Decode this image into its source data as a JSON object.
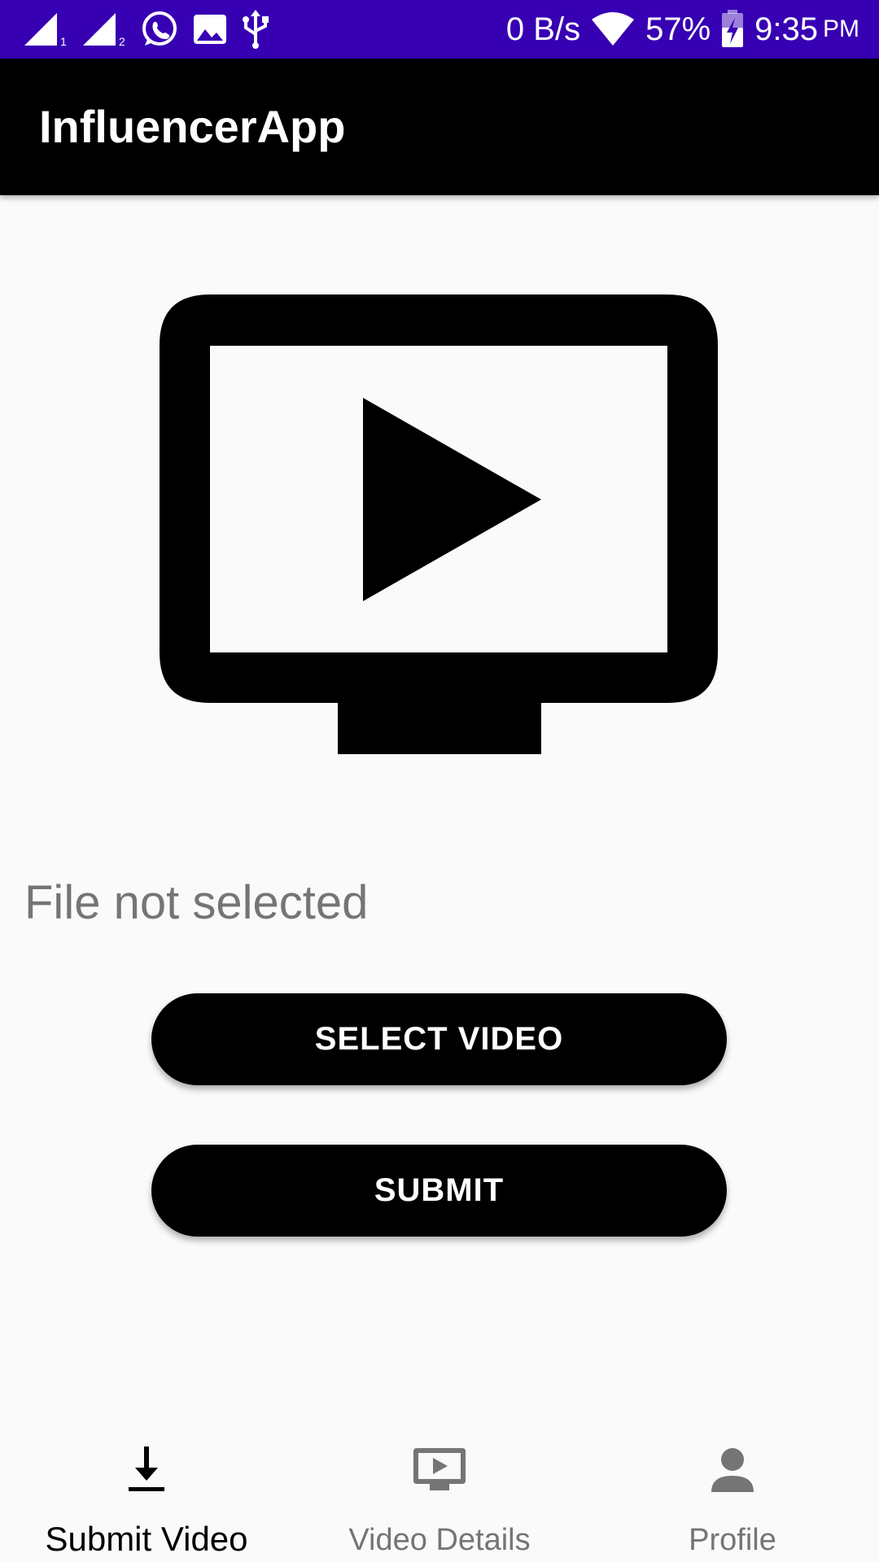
{
  "status_bar": {
    "network_speed": "0 B/s",
    "battery": "57%",
    "time": "9:35",
    "ampm": "PM",
    "background_color": "#3700b3",
    "icons": [
      "signal-sim1-icon",
      "signal-sim2-icon",
      "whatsapp-icon",
      "gallery-icon",
      "usb-icon",
      "wifi-icon",
      "battery-charging-icon"
    ]
  },
  "app_bar": {
    "title": "InfluencerApp"
  },
  "main": {
    "hero_icon": "tv-play-icon",
    "file_status": "File not selected",
    "select_video_label": "SELECT VIDEO",
    "submit_label": "SUBMIT"
  },
  "bottom_nav": {
    "items": [
      {
        "label": "Submit Video",
        "icon": "download-icon",
        "active": true
      },
      {
        "label": "Video Details",
        "icon": "ondemand-video-icon",
        "active": false
      },
      {
        "label": "Profile",
        "icon": "person-icon",
        "active": false
      }
    ]
  }
}
